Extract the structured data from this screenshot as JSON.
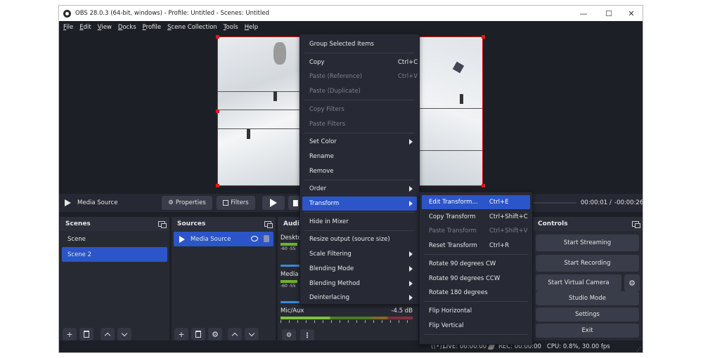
{
  "window": {
    "title": "OBS 28.0.3 (64-bit, windows) - Profile: Untitled - Scenes: Untitled",
    "controls": {
      "minimize": "—",
      "maximize": "☐",
      "close": "✕"
    }
  },
  "menubar": {
    "items": [
      {
        "u": "F",
        "rest": "ile"
      },
      {
        "u": "E",
        "rest": "dit"
      },
      {
        "u": "V",
        "rest": "iew"
      },
      {
        "u": "D",
        "rest": "ocks"
      },
      {
        "u": "P",
        "rest": "rofile"
      },
      {
        "u": "S",
        "rest": "cene Collection"
      },
      {
        "u": "T",
        "rest": "ools"
      },
      {
        "u": "H",
        "rest": "elp"
      }
    ]
  },
  "media_bar": {
    "source_name": "Media Source",
    "properties_label": "Properties",
    "filters_label": "Filters",
    "time_current": "00:00:01",
    "time_sep": "/",
    "time_remaining": "-00:00:26"
  },
  "scenes": {
    "title": "Scenes",
    "items": [
      "Scene",
      "Scene 2"
    ],
    "selected": 1
  },
  "sources": {
    "title": "Sources",
    "items": [
      {
        "name": "Media Source",
        "visible": true,
        "locked": false
      }
    ]
  },
  "audio": {
    "title": "Audi",
    "channels": [
      {
        "name": "Desktc",
        "ticks": "-60  -55"
      },
      {
        "name": "Media",
        "ticks": "-60  -55"
      },
      {
        "name": "Mic/Aux",
        "db": "-4.5 dB"
      }
    ]
  },
  "controls": {
    "title": "Controls",
    "buttons": [
      "Start Streaming",
      "Start Recording",
      "Start Virtual Camera",
      "Studio Mode",
      "Settings",
      "Exit"
    ]
  },
  "context_menu": {
    "items": [
      {
        "label": "Group Selected Items"
      },
      {
        "sep": true
      },
      {
        "label": "Copy",
        "shortcut": "Ctrl+C"
      },
      {
        "label": "Paste (Reference)",
        "shortcut": "Ctrl+V",
        "disabled": true
      },
      {
        "label": "Paste (Duplicate)",
        "disabled": true
      },
      {
        "sep": true
      },
      {
        "label": "Copy Filters",
        "disabled": true
      },
      {
        "label": "Paste Filters",
        "disabled": true
      },
      {
        "sep": true
      },
      {
        "label": "Set Color",
        "submenu": true
      },
      {
        "label": "Rename"
      },
      {
        "label": "Remove"
      },
      {
        "sep": true
      },
      {
        "label": "Order",
        "submenu": true
      },
      {
        "label": "Transform",
        "submenu": true,
        "active": true
      },
      {
        "sep": true
      },
      {
        "label": "Hide in Mixer"
      },
      {
        "sep": true
      },
      {
        "label": "Resize output (source size)"
      },
      {
        "label": "Scale Filtering",
        "submenu": true
      },
      {
        "label": "Blending Mode",
        "submenu": true
      },
      {
        "label": "Blending Method",
        "submenu": true
      },
      {
        "label": "Deinterlacing",
        "submenu": true
      }
    ]
  },
  "transform_menu": {
    "items": [
      {
        "label": "Edit Transform...",
        "shortcut": "Ctrl+E",
        "active": true
      },
      {
        "label": "Copy Transform",
        "shortcut": "Ctrl+Shift+C"
      },
      {
        "label": "Paste Transform",
        "shortcut": "Ctrl+Shift+V",
        "disabled": true
      },
      {
        "label": "Reset Transform",
        "shortcut": "Ctrl+R"
      },
      {
        "sep": true
      },
      {
        "label": "Rotate 90 degrees CW"
      },
      {
        "label": "Rotate 90 degrees CCW"
      },
      {
        "label": "Rotate 180 degrees"
      },
      {
        "sep": true
      },
      {
        "label": "Flip Horizontal"
      },
      {
        "label": "Flip Vertical"
      },
      {
        "sep": true
      }
    ]
  },
  "statusbar": {
    "live": "LIVE: 00:00:00",
    "rec": "REC: 00:00:00",
    "cpu": "CPU: 0.8%, 30.00 fps"
  },
  "colors": {
    "accent": "#2b55c9",
    "selection_border": "#e01818",
    "bg": "#1d1f26"
  }
}
